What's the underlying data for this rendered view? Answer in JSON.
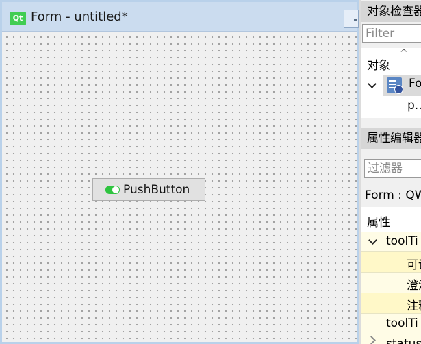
{
  "form_window": {
    "logo_text": "Qt",
    "title": "Form - untitled*",
    "push_button_label": "PushButton"
  },
  "object_inspector": {
    "title": "对象检查器",
    "filter_placeholder": "Filter",
    "column_header": "对象",
    "sort_indicator": "^",
    "root_object_name": "Fo",
    "child_object_name": "p..."
  },
  "property_editor": {
    "title": "属性编辑器",
    "filter_placeholder": "过滤器",
    "class_label": "Form : QW",
    "column_header": "属性",
    "rows": [
      {
        "name": "toolTi",
        "expanded": true
      },
      {
        "name": "可读"
      },
      {
        "name": "澄清"
      },
      {
        "name": "注释"
      },
      {
        "name": "toolTi"
      },
      {
        "name": "statusT"
      }
    ]
  }
}
